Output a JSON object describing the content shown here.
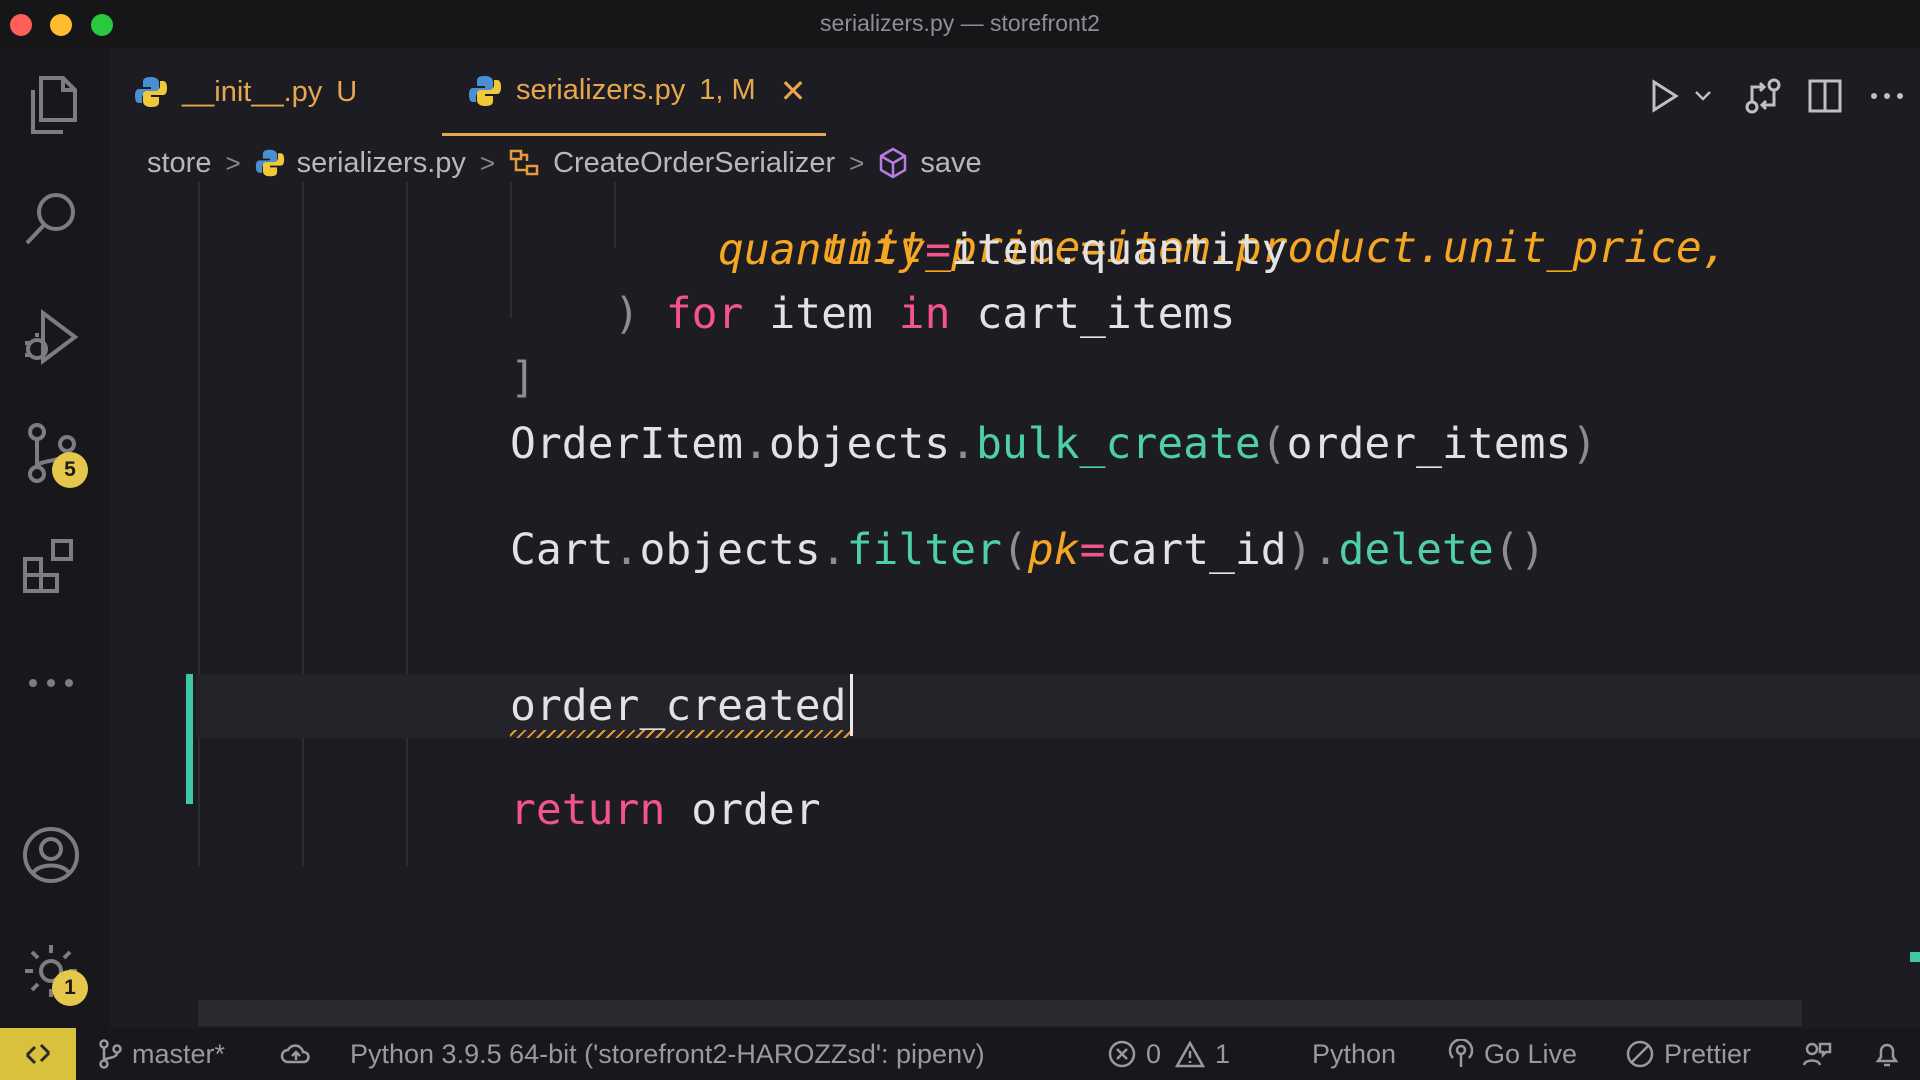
{
  "window": {
    "title": "serializers.py — storefront2"
  },
  "activity_bar": {
    "source_control_badge": "5",
    "settings_badge": "1"
  },
  "tabs": [
    {
      "name": "__init__.py",
      "status": "U"
    },
    {
      "name": "serializers.py",
      "status": "1, M"
    }
  ],
  "breadcrumbs": {
    "folder": "store",
    "file": "serializers.py",
    "class": "CreateOrderSerializer",
    "method": "save"
  },
  "code": {
    "line_partial": "unit_price=item.product.unit_price,",
    "line1_param": "quantity",
    "line1_op": "=",
    "line1_rest": "item.quantity",
    "line2_paren": ")",
    "line2_for": "for",
    "line2_item": "item",
    "line2_in": "in",
    "line2_cart": "cart_items",
    "line3_bracket": "]",
    "line4_obj": "OrderItem",
    "line4_objects": "objects",
    "line4_fn": "bulk_create",
    "line4_arg": "order_items",
    "line5_obj": "Cart",
    "line5_objects": "objects",
    "line5_fn": "filter",
    "line5_param": "pk",
    "line5_val": "cart_id",
    "line5_fn2": "delete",
    "line6": "order_created",
    "line7_kw": "return",
    "line7_val": "order"
  },
  "status_bar": {
    "branch": "master*",
    "interpreter": "Python 3.9.5 64-bit ('storefront2-HAROZZsd': pipenv)",
    "errors": "0",
    "warnings": "1",
    "language": "Python",
    "go_live": "Go Live",
    "prettier": "Prettier"
  },
  "colors": {
    "keyword": "#f2548b",
    "function": "#4ecfa9",
    "parameter": "#f5a623",
    "accent_tab": "#e6a74e",
    "badge": "#e4c74b",
    "git_gutter_added": "#3ec9a6"
  }
}
